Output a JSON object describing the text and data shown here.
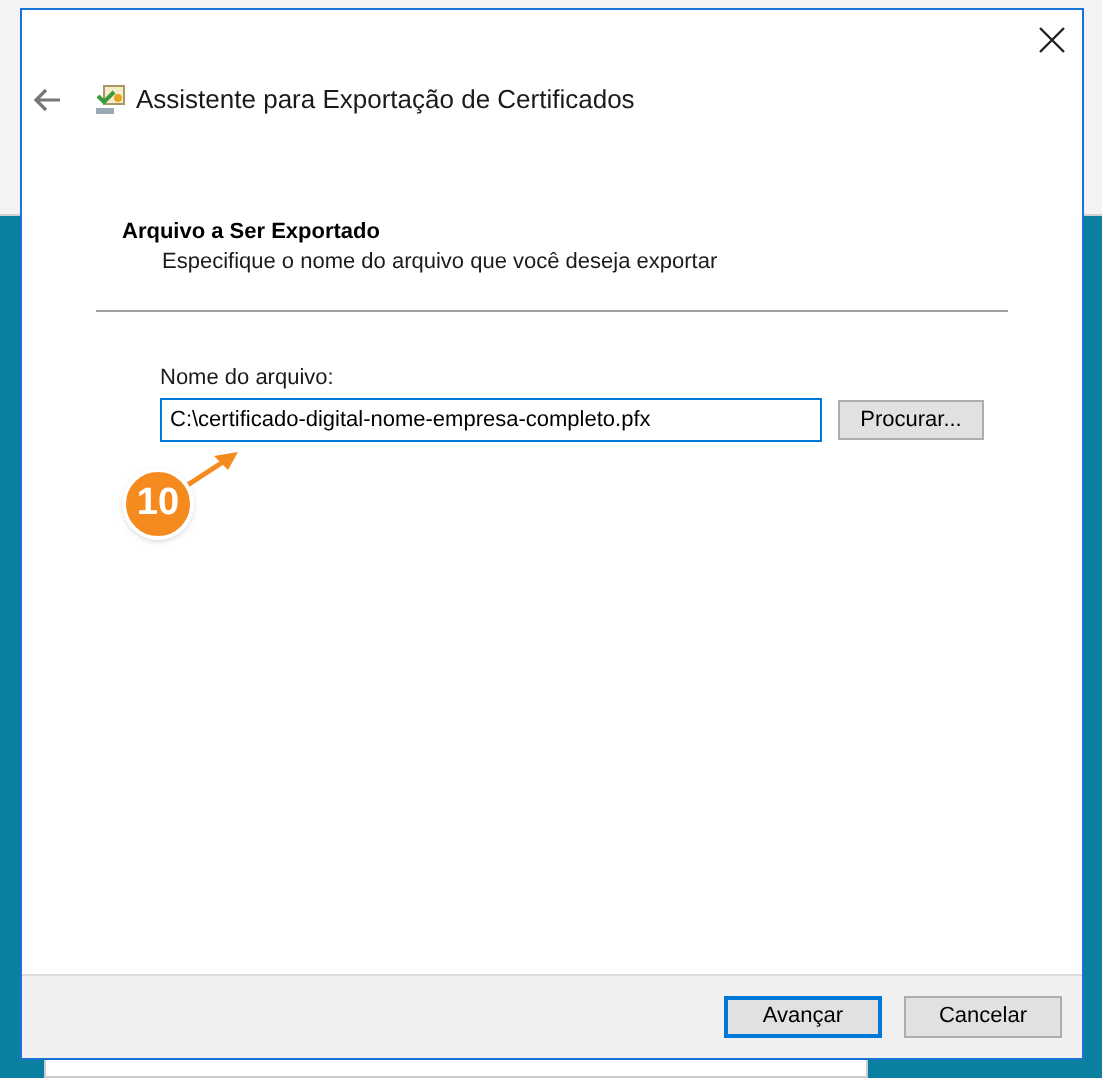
{
  "window": {
    "title": "Assistente para Exportação de Certificados"
  },
  "page": {
    "heading": "Arquivo a Ser Exportado",
    "description": "Especifique o nome do arquivo que você deseja exportar"
  },
  "file_field": {
    "label": "Nome do arquivo:",
    "value": "C:\\certificado-digital-nome-empresa-completo.pfx"
  },
  "browse_button": "Procurar...",
  "callout": {
    "number": "10"
  },
  "buttons": [
    {
      "label": "Avançar",
      "default": true
    },
    {
      "label": "Cancelar",
      "default": false
    }
  ]
}
